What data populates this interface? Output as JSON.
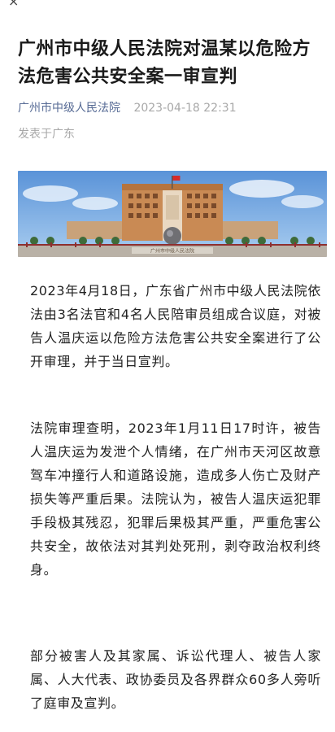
{
  "nav": {
    "close_glyph": "×"
  },
  "article": {
    "title": "广州市中级人民法院对温某以危险方法危害公共安全案一审宣判",
    "source": "广州市中级人民法院",
    "published_at": "2023-04-18 22:31",
    "location": "发表于广东",
    "image": {
      "sign_text": "广州市中级人民法院"
    },
    "paragraphs": [
      "2023年4月18日，广东省广州市中级人民法院依法由3名法官和4名人民陪审员组成合议庭，对被告人温庆运以危险方法危害公共安全案进行了公开审理，并于当日宣判。",
      "法院审理查明，2023年1月11日17时许，被告人温庆运为发泄个人情绪，在广州市天河区故意驾车冲撞行人和道路设施，造成多人伤亡及财产损失等严重后果。法院认为，被告人温庆运犯罪手段极其残忍，犯罪后果极其严重，严重危害公共安全，故依法对其判处死刑，剥夺政治权利终身。",
      "部分被害人及其家属、诉讼代理人、被告人家属、人大代表、政协委员及各界群众60多人旁听了庭审及宣判。"
    ]
  },
  "colors": {
    "source_link": "#576b95",
    "meta_gray": "#a8a8a8",
    "body_text": "#222222"
  }
}
